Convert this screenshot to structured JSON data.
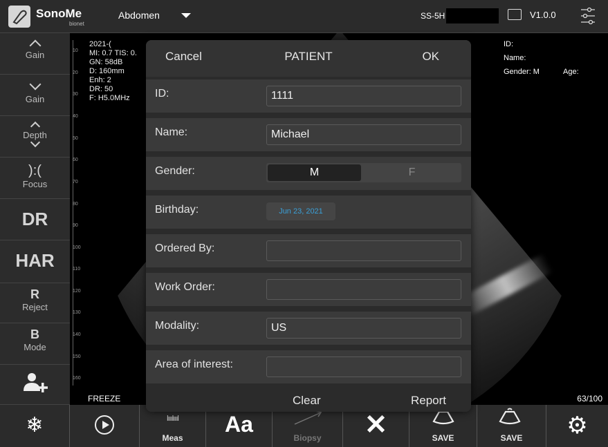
{
  "header": {
    "brand": "SonoMe",
    "brand_sub": "bionet",
    "preset": "Abdomen",
    "probe": "SS-5H",
    "version": "V1.0.0"
  },
  "left_panel": {
    "gain_up_label": "Gain",
    "gain_down_label": "Gain",
    "depth_label": "Depth",
    "focus_label": "Focus",
    "focus_glyph": "):(",
    "dr_label": "DR",
    "har_label": "HAR",
    "reject_big": "R",
    "reject_label": "Reject",
    "bmode_big": "B",
    "bmode_label": "Mode"
  },
  "scan_info": {
    "date": "2021-(",
    "mi_tis": "MI: 0.7  TIS: 0.",
    "gain": "GN: 58dB",
    "depth": "D: 160mm",
    "enh": "Enh: 2",
    "dr": "DR: 50",
    "freq": "F: H5.0MHz",
    "freeze": "FREEZE",
    "frame_count": "63/100"
  },
  "ruler_ticks": [
    "10",
    "20",
    "30",
    "40",
    "50",
    "60",
    "70",
    "80",
    "90",
    "100",
    "110",
    "120",
    "130",
    "140",
    "150",
    "160"
  ],
  "patient_info": {
    "id_label": "ID:",
    "name_label": "Name:",
    "gender": "Gender: M",
    "age_label": "Age:"
  },
  "modal": {
    "cancel": "Cancel",
    "title": "PATIENT",
    "ok": "OK",
    "fields": {
      "id_label": "ID:",
      "id_value": "1111",
      "name_label": "Name:",
      "name_value": "Michael",
      "gender_label": "Gender:",
      "gender_m": "M",
      "gender_f": "F",
      "birthday_label": "Birthday:",
      "birthday_value": "Jun 23, 2021",
      "ordered_by_label": "Ordered By:",
      "ordered_by_value": "",
      "work_order_label": "Work Order:",
      "work_order_value": "",
      "modality_label": "Modality:",
      "modality_value": "US",
      "area_label": "Area of interest:",
      "area_value": ""
    },
    "clear": "Clear",
    "report": "Report"
  },
  "bottom_bar": {
    "meas_label": "Meas",
    "meas_glyph": "lııılıııl",
    "annot_label": "Aa",
    "biopsy_label": "Biopsy",
    "delete_glyph": "✕",
    "save_image_label": "SAVE",
    "save_cine_label": "SAVE",
    "freeze_glyph": "❄",
    "settings_glyph": "⚙"
  },
  "colors": {
    "accent_date": "#3aa0d8",
    "panel": "#2b2b2b",
    "row": "#3a3a3a"
  }
}
